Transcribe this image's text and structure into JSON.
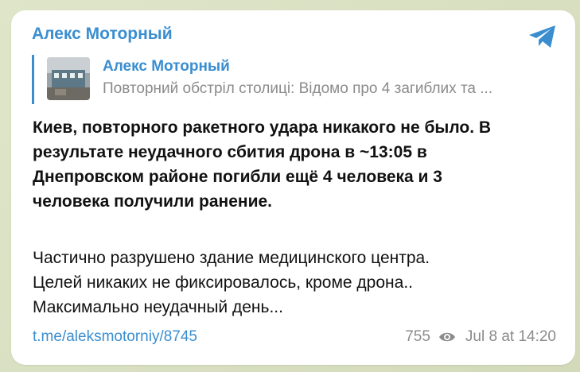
{
  "post": {
    "author": "Алекс Моторный",
    "reply": {
      "author": "Алекс Моторный",
      "preview": "Повторний обстріл столиці: Відомо про 4 загиблих та ..."
    },
    "body_bold_lines": [
      "Киев, повторного ракетного удара никакого не было. В",
      "результате неудачного сбития дрона в ~13:05 в",
      "Днепровском районе погибли ещё 4 человека и 3",
      "человека получили ранение."
    ],
    "body_plain_lines": [
      "Частично разрушено здание медицинского центра.",
      "Целей никаких не фиксировалось, кроме дрона..",
      "Максимально неудачный день..."
    ],
    "link": "t.me/aleksmotorniy/8745",
    "views": "755",
    "timestamp": "Jul 8 at 14:20"
  },
  "icons": {
    "send": "telegram-send-icon",
    "views": "eye-icon"
  },
  "colors": {
    "accent": "#3a8ed0",
    "muted": "#8b8b8b",
    "background": "#d9dfc4",
    "card": "#ffffff"
  }
}
